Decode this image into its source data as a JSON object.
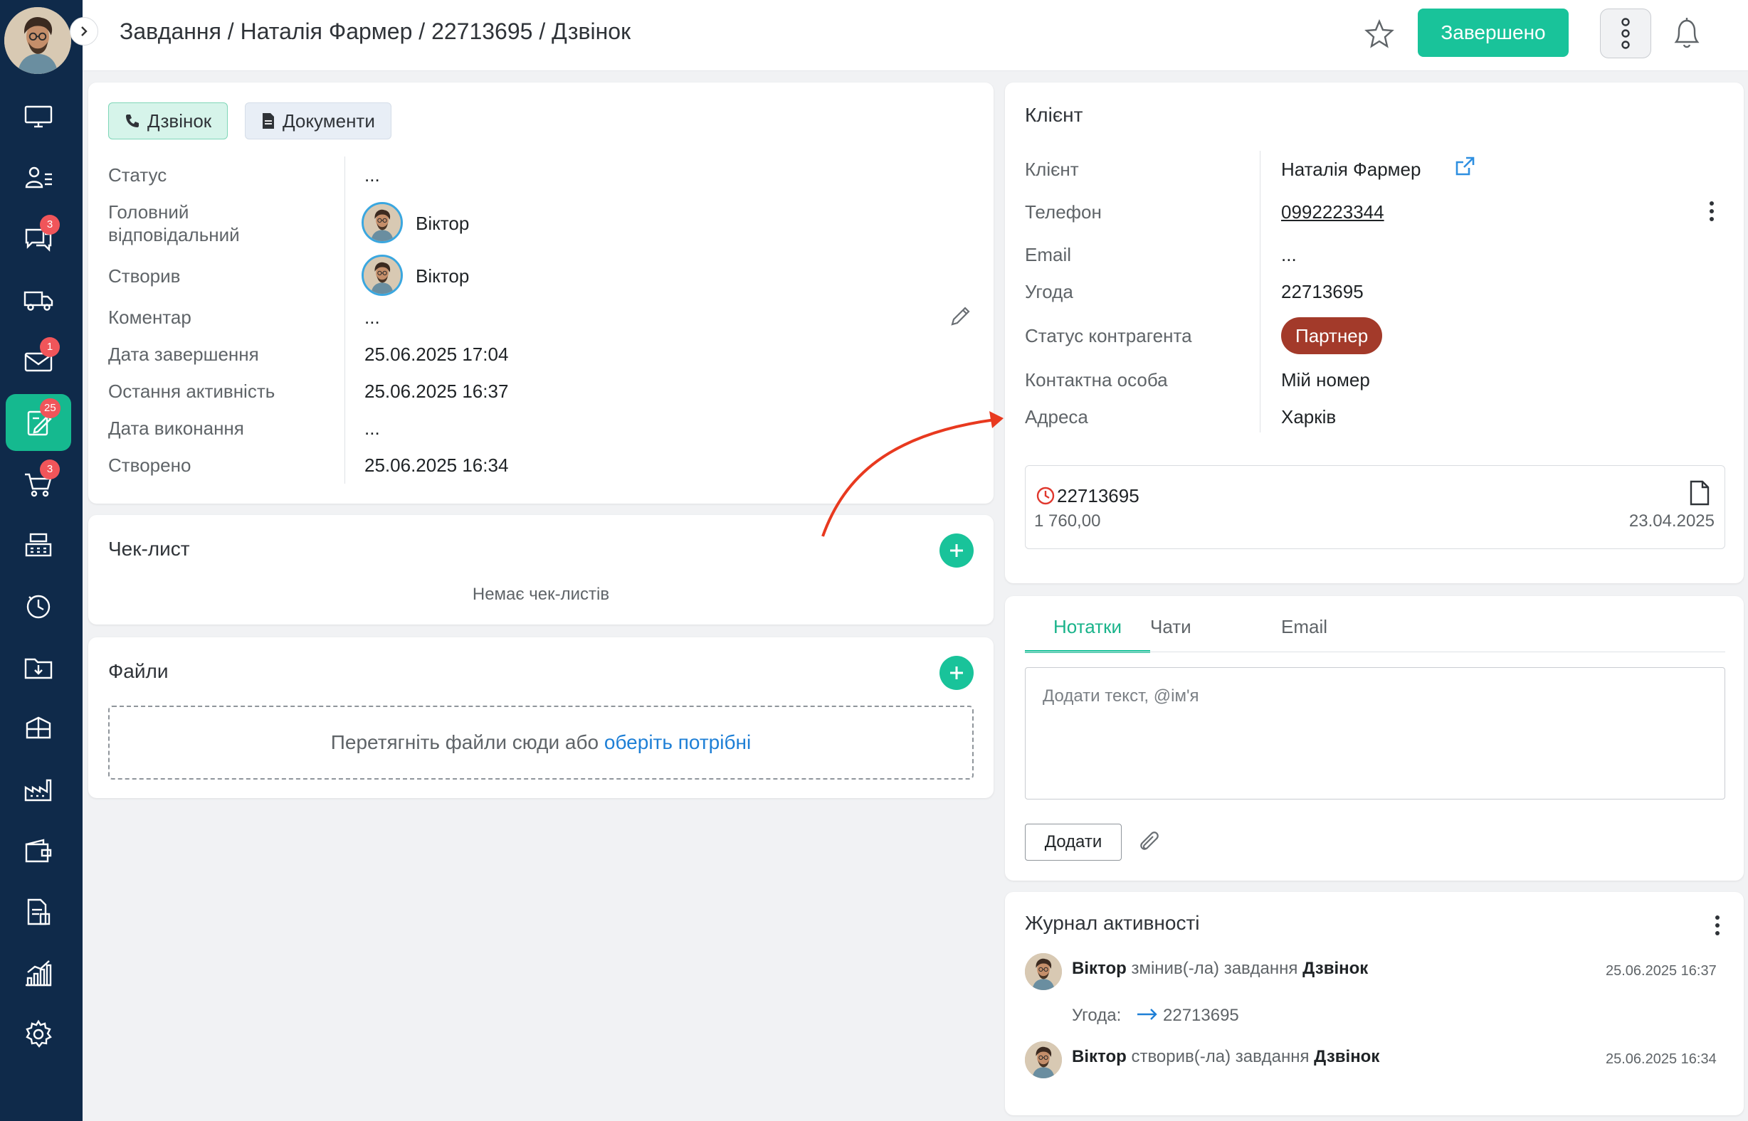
{
  "header": {
    "breadcrumb": "Завдання / Наталія Фармер / 22713695 / Дзвінок",
    "done_label": "Завершено"
  },
  "sidebar": {
    "items": [
      {
        "icon": "monitor-icon",
        "badge": ""
      },
      {
        "icon": "contacts-icon",
        "badge": ""
      },
      {
        "icon": "chat-icon",
        "badge": "3"
      },
      {
        "icon": "truck-icon",
        "badge": ""
      },
      {
        "icon": "mail-icon",
        "badge": "1"
      },
      {
        "icon": "tasks-icon",
        "badge": "25"
      },
      {
        "icon": "cart-icon",
        "badge": "3"
      },
      {
        "icon": "cash-register-icon",
        "badge": ""
      },
      {
        "icon": "clock-icon",
        "badge": ""
      },
      {
        "icon": "folder-download-icon",
        "badge": ""
      },
      {
        "icon": "box-icon",
        "badge": ""
      },
      {
        "icon": "factory-icon",
        "badge": ""
      },
      {
        "icon": "wallet-icon",
        "badge": ""
      },
      {
        "icon": "report-icon",
        "badge": ""
      },
      {
        "icon": "chart-icon",
        "badge": ""
      },
      {
        "icon": "settings-icon",
        "badge": ""
      }
    ]
  },
  "task": {
    "tabs": {
      "call": "Дзвінок",
      "documents": "Документи"
    },
    "fields": {
      "status_label": "Статус",
      "status_value": "...",
      "responsible_label_1": "Головний",
      "responsible_label_2": "відповідальний",
      "responsible_value": "Віктор",
      "created_by_label": "Створив",
      "created_by_value": "Віктор",
      "comment_label": "Коментар",
      "comment_value": "...",
      "completion_label": "Дата завершення",
      "completion_value": "25.06.2025 17:04",
      "last_activity_label": "Остання активність",
      "last_activity_value": "25.06.2025 16:37",
      "execution_label": "Дата виконання",
      "execution_value": "...",
      "created_label": "Створено",
      "created_value": "25.06.2025 16:34"
    }
  },
  "checklist": {
    "title": "Чек-лист",
    "empty": "Немає чек-листів"
  },
  "files": {
    "title": "Файли",
    "drop_text": "Перетягніть файли сюди або",
    "drop_link": "оберіть потрібні"
  },
  "client": {
    "title": "Клієнт",
    "client_label": "Клієнт",
    "client_value": "Наталія Фармер",
    "phone_label": "Телефон",
    "phone_value": "0992223344",
    "email_label": "Email",
    "email_value": "...",
    "deal_label": "Угода",
    "deal_value": "22713695",
    "status_label": "Статус контрагента",
    "status_value": "Партнер",
    "status_color": "#a33a2a",
    "contact_label": "Контактна особа",
    "contact_value": "Мій номер",
    "address_label": "Адреса",
    "address_value": "Харків",
    "deal_card": {
      "number": "22713695",
      "amount": "1 760,00",
      "date": "23.04.2025"
    }
  },
  "notes": {
    "tabs": [
      "Нотатки",
      "Чати",
      "Email"
    ],
    "placeholder": "Додати текст, @ім'я",
    "add_label": "Додати"
  },
  "activity": {
    "title": "Журнал активності",
    "entries": [
      {
        "user": "Віктор",
        "action": "змінив(-ла) завдання",
        "object": "Дзвінок",
        "time": "25.06.2025 16:37",
        "detail_label": "Угода:",
        "detail_value": "22713695"
      },
      {
        "user": "Віктор",
        "action": "створив(-ла) завдання",
        "object": "Дзвінок",
        "time": "25.06.2025 16:34"
      }
    ]
  },
  "colors": {
    "accent": "#19c39a",
    "sidebar": "#0f2a4a",
    "badge": "#f0555a",
    "link": "#1e7fd6"
  }
}
